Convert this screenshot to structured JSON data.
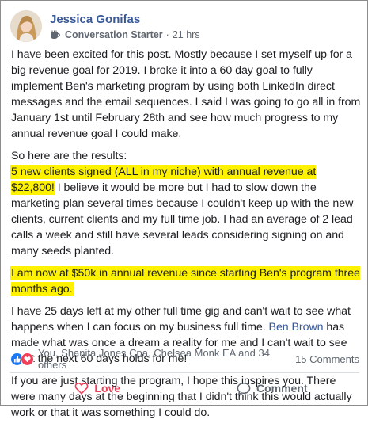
{
  "post": {
    "author": "Jessica Gonifas",
    "badge": "Conversation Starter",
    "separator": "·",
    "time": "21 hrs",
    "paragraphs": {
      "p1": "I have been excited for this post. Mostly because I set myself up for a big revenue goal for 2019. I broke it into a 60 day goal to fully implement Ben's marketing program by using both LinkedIn direct messages and the email sequences. I said I was going to go all in from January 1st until February 28th and see how much progress to my annual revenue goal I could make.",
      "p2": "So here are the results:",
      "p3_highlight": "5 new clients signed (ALL in my niche) with annual revenue at $22,800!",
      "p3_rest": " I believe it would be more but I had to slow down the marketing plan several times because I couldn't keep up with the new clients, current clients and my full time job. I had an average of 2 lead calls a week and still have several leads considering signing on and many seeds planted.",
      "p4_highlight": "I am now at $50k in annual revenue since starting Ben's program three months ago.",
      "p5_before": "I have 25 days left at my other full time gig and can't wait to see what happens when I can focus on my business full time. ",
      "p5_link": "Ben Brown",
      "p5_after": " has made what was once a dream a reality for me and I can't wait to see what the next 60 days holds for me!",
      "p6": "If you are just starting the program, I hope this inspires you. There were many days at the beginning that I didn't think this would actually work or that it was something I could do."
    }
  },
  "reactions": {
    "text": "You, Shanita Jones Cpa, Chelsea Monk EA and 34 others",
    "comments": "15 Comments",
    "icons": [
      "like-icon",
      "love-icon"
    ]
  },
  "actions": {
    "love_label": "Love",
    "comment_label": "Comment"
  },
  "colors": {
    "link": "#385898",
    "highlight": "#fff200",
    "love": "#f33e58",
    "like": "#1877f2"
  }
}
